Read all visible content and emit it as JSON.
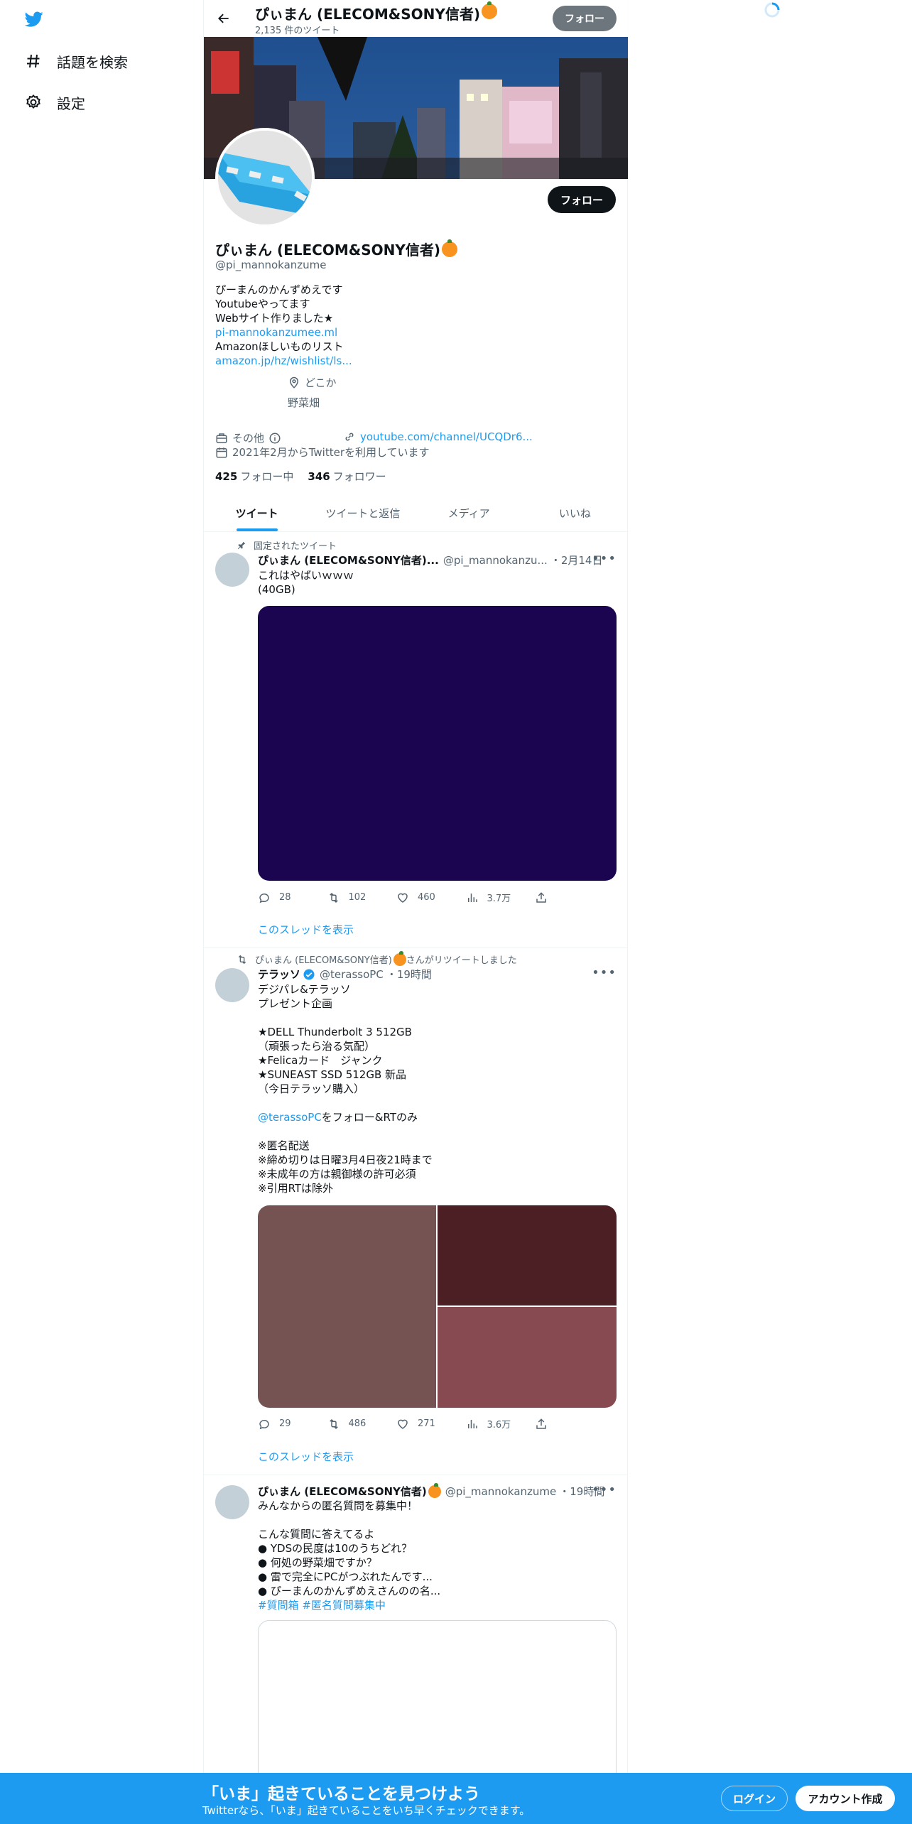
{
  "sidebar": {
    "items": [
      {
        "label": "話題を検索",
        "icon": "hashtag-icon"
      },
      {
        "label": "設定",
        "icon": "gear-icon"
      }
    ]
  },
  "header": {
    "name": "ぴぃまん (ELECOM&SONY信者)",
    "tweet_count": "2,135 件のツイート",
    "follow_label": "フォロー"
  },
  "profile": {
    "name": "ぴぃまん (ELECOM&SONY信者)",
    "handle": "@pi_mannokanzume",
    "follow_label": "フォロー",
    "bio": [
      "ぴーまんのかんずめえです",
      "Youtubeやってます",
      "Webサイト作りました★"
    ],
    "bio_link1": "pi-mannokanzumee.ml",
    "bio_line4": "Amazonほしいものリスト",
    "bio_link2": "amazon.jp/hz/wishlist/ls...",
    "location_line1": "どこか",
    "location_line2": "野菜畑",
    "category": "その他",
    "website": "youtube.com/channel/UCQDr6...",
    "joined": "2021年2月からTwitterを利用しています",
    "following_count": "425",
    "following_label": "フォロー中",
    "followers_count": "346",
    "followers_label": "フォロワー"
  },
  "tabs": [
    "ツイート",
    "ツイートと返信",
    "メディア",
    "いいね"
  ],
  "tweets": [
    {
      "context": "固定されたツイート",
      "name": "ぴぃまん (ELECOM&SONY信者)...",
      "handle": "@pi_mannokanzu...",
      "time": "・2月14日",
      "text": [
        "これはやばいｗｗｗ",
        "(40GB)"
      ],
      "replies": "28",
      "retweets": "102",
      "likes": "460",
      "views": "3.7万",
      "thread": "このスレッドを表示",
      "media_color": "#1c0550"
    },
    {
      "context": "ぴぃまん (ELECOM&SONY信者)",
      "context_suffix": "さんがリツイートしました",
      "name": "テラッソ",
      "handle": "@terassoPC",
      "time": "・19時間",
      "text": [
        "デジパレ&テラッソ",
        "プレゼント企画",
        "",
        "★DELL Thunderbolt 3 512GB",
        "（頑張ったら治る気配）",
        "★Felicaカード　ジャンク",
        "★SUNEAST SSD 512GB 新品",
        "（今日テラッソ購入）",
        ""
      ],
      "mention": "@terassoPC",
      "mention_suffix": "をフォロー&RTのみ",
      "text2": [
        "",
        "※匿名配送",
        "※締め切りは日曜3月4日夜21時まで",
        "※未成年の方は親御様の許可必須",
        "※引用RTは除外"
      ],
      "replies": "29",
      "retweets": "486",
      "likes": "271",
      "views": "3.6万",
      "thread": "このスレッドを表示",
      "media_colors": [
        "#745352",
        "#4b1f23",
        "#874a51"
      ]
    },
    {
      "name": "ぴぃまん (ELECOM&SONY信者)",
      "handle": "@pi_mannokanzume",
      "time": "・19時間",
      "text": [
        "みんなからの匿名質問を募集中！",
        "",
        "こんな質問に答えてるよ",
        "● YDSの民度は10のうちどれ？",
        "● 何処の野菜畑ですか？",
        "● 雷で完全にPCがつぶれたんです...",
        "● ぴーまんのかんずめえさんのの名..."
      ],
      "hashtags": "#質問箱 #匿名質問募集中"
    }
  ],
  "bottom_bar": {
    "headline": "「いま」起きていることを見つけよう",
    "sub": "Twitterなら、「いま」起きていることをいち早くチェックできます。",
    "login": "ログイン",
    "signup": "アカウント作成"
  },
  "colors": {
    "accent": "#1d9bf0",
    "text": "#0f1419",
    "muted": "#536471"
  }
}
